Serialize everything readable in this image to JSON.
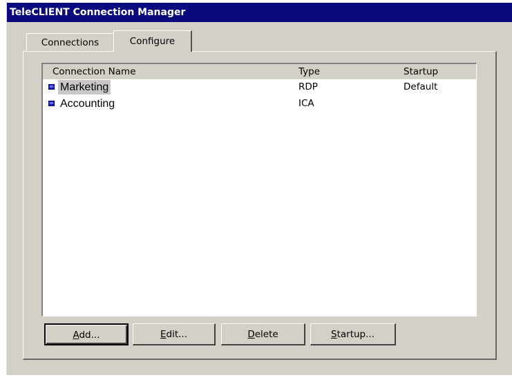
{
  "window": {
    "title": "TeleCLIENT Connection Manager"
  },
  "tabs": [
    {
      "label": "Connections",
      "active": false
    },
    {
      "label": "Configure",
      "active": true
    }
  ],
  "list": {
    "columns": [
      "Connection Name",
      "Type",
      "Startup"
    ],
    "rows": [
      {
        "name": "Marketing",
        "type": "RDP",
        "startup": "Default",
        "selected": true,
        "icon": "connection-icon"
      },
      {
        "name": "Accounting",
        "type": "ICA",
        "startup": "",
        "selected": false,
        "icon": "connection-icon"
      }
    ]
  },
  "buttons": {
    "add": {
      "mnemonic": "A",
      "rest": "dd..."
    },
    "edit": {
      "mnemonic": "E",
      "rest": "dit..."
    },
    "delete": {
      "mnemonic": "D",
      "rest": "elete"
    },
    "startup": {
      "mnemonic": "S",
      "rest": "tartup..."
    }
  },
  "colors": {
    "titlebar": "#0a0a7e",
    "face": "#d4d0c8",
    "selection": "#c8c8c8"
  }
}
